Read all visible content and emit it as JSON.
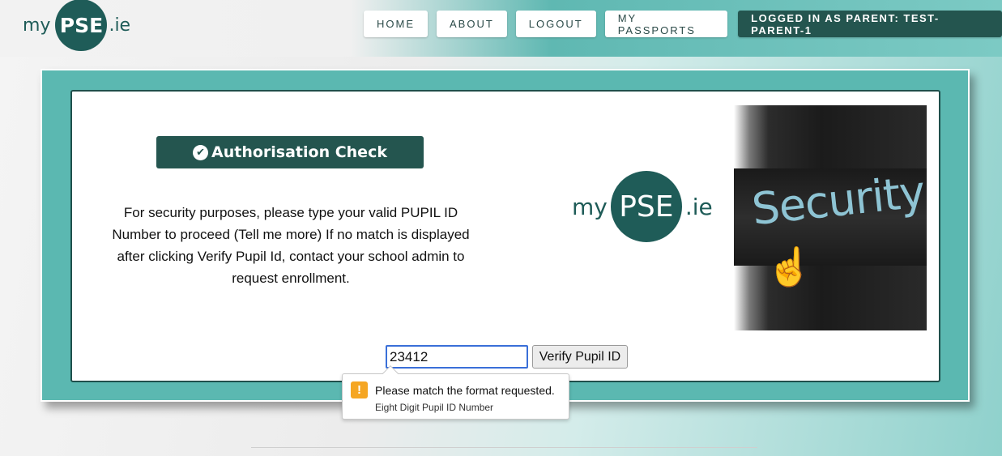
{
  "header": {
    "logo": {
      "prefix": "my",
      "circle": "PSE",
      "suffix": ".ie"
    },
    "nav": [
      {
        "label": "HOME"
      },
      {
        "label": "ABOUT"
      },
      {
        "label": "LOGOUT"
      },
      {
        "label": "MY PASSPORTS"
      }
    ],
    "user_badge": "LOGGED IN AS PARENT: TEST-PARENT-1"
  },
  "main": {
    "auth_title": "Authorisation Check",
    "instructions": "For security purposes, please type your valid PUPIL ID Number to proceed (Tell me more) If no match is displayed after clicking Verify Pupil Id, contact your school admin to request enrollment.",
    "logo": {
      "prefix": "my",
      "circle": "PSE",
      "suffix": ".ie"
    },
    "security_image_text": "Security",
    "pupil_input_value": "23412",
    "verify_button": "Verify Pupil ID"
  },
  "validation_tooltip": {
    "message": "Please match the format requested.",
    "detail": "Eight Digit Pupil ID Number"
  },
  "colors": {
    "brand_dark": "#24554f",
    "teal_panel": "#5bb8b1",
    "warning": "#f5a623"
  }
}
